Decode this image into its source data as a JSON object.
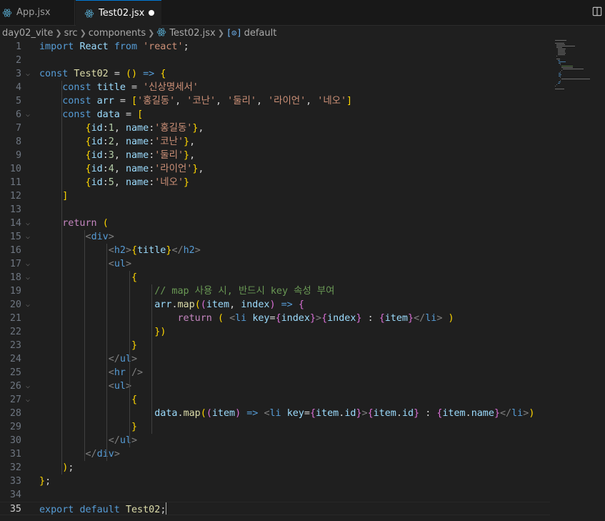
{
  "tabs": [
    {
      "label": "App.jsx",
      "active": false
    },
    {
      "label": "Test02.jsx",
      "active": true,
      "dirty": true
    }
  ],
  "breadcrumb": {
    "items": [
      "day02_vite",
      "src",
      "components",
      "Test02.jsx",
      "default"
    ]
  },
  "editor": {
    "current_line": 35,
    "line_numbers": [
      "1",
      "2",
      "3",
      "4",
      "5",
      "6",
      "7",
      "8",
      "9",
      "10",
      "11",
      "12",
      "13",
      "14",
      "15",
      "16",
      "17",
      "18",
      "19",
      "20",
      "21",
      "22",
      "23",
      "24",
      "25",
      "26",
      "27",
      "28",
      "29",
      "30",
      "31",
      "32",
      "33",
      "34",
      "35"
    ],
    "lines": [
      "import React from 'react';",
      "",
      "const Test02 = () => {",
      "    const title = '신상명세서'",
      "    const arr = ['홍길동', '코난', '둘리', '라이언', '네오']",
      "    const data = [",
      "        {id:1, name:'홍길동'},",
      "        {id:2, name:'코난'},",
      "        {id:3, name:'둘리'},",
      "        {id:4, name:'라이언'},",
      "        {id:5, name:'네오'}",
      "    ]",
      "",
      "    return (",
      "        <div>",
      "            <h2>{title}</h2>",
      "            <ul>",
      "                {",
      "                    // map 사용 시, 반드시 key 속성 부여",
      "                    arr.map((item, index) => {",
      "                        return ( <li key={index}>{index} : {item}</li> )",
      "                    })",
      "                }",
      "            </ul>",
      "            <hr />",
      "            <ul>",
      "                {",
      "                    data.map((item) => <li key={item.id}>{item.id} : {item.name}</li>)",
      "                }",
      "            </ul>",
      "        </div>",
      "    );",
      "};",
      "",
      "export default Test02;"
    ]
  },
  "colors": {
    "background": "#1f1f1f",
    "keyword": "#569cd6",
    "control": "#c586c0",
    "string": "#ce9178",
    "variable": "#9cdcfe",
    "comment": "#6a9955"
  },
  "icons": {
    "tab_icon": "react-icon",
    "split_editor": "split-editor-icon",
    "symbol": "symbol-variable-icon"
  }
}
